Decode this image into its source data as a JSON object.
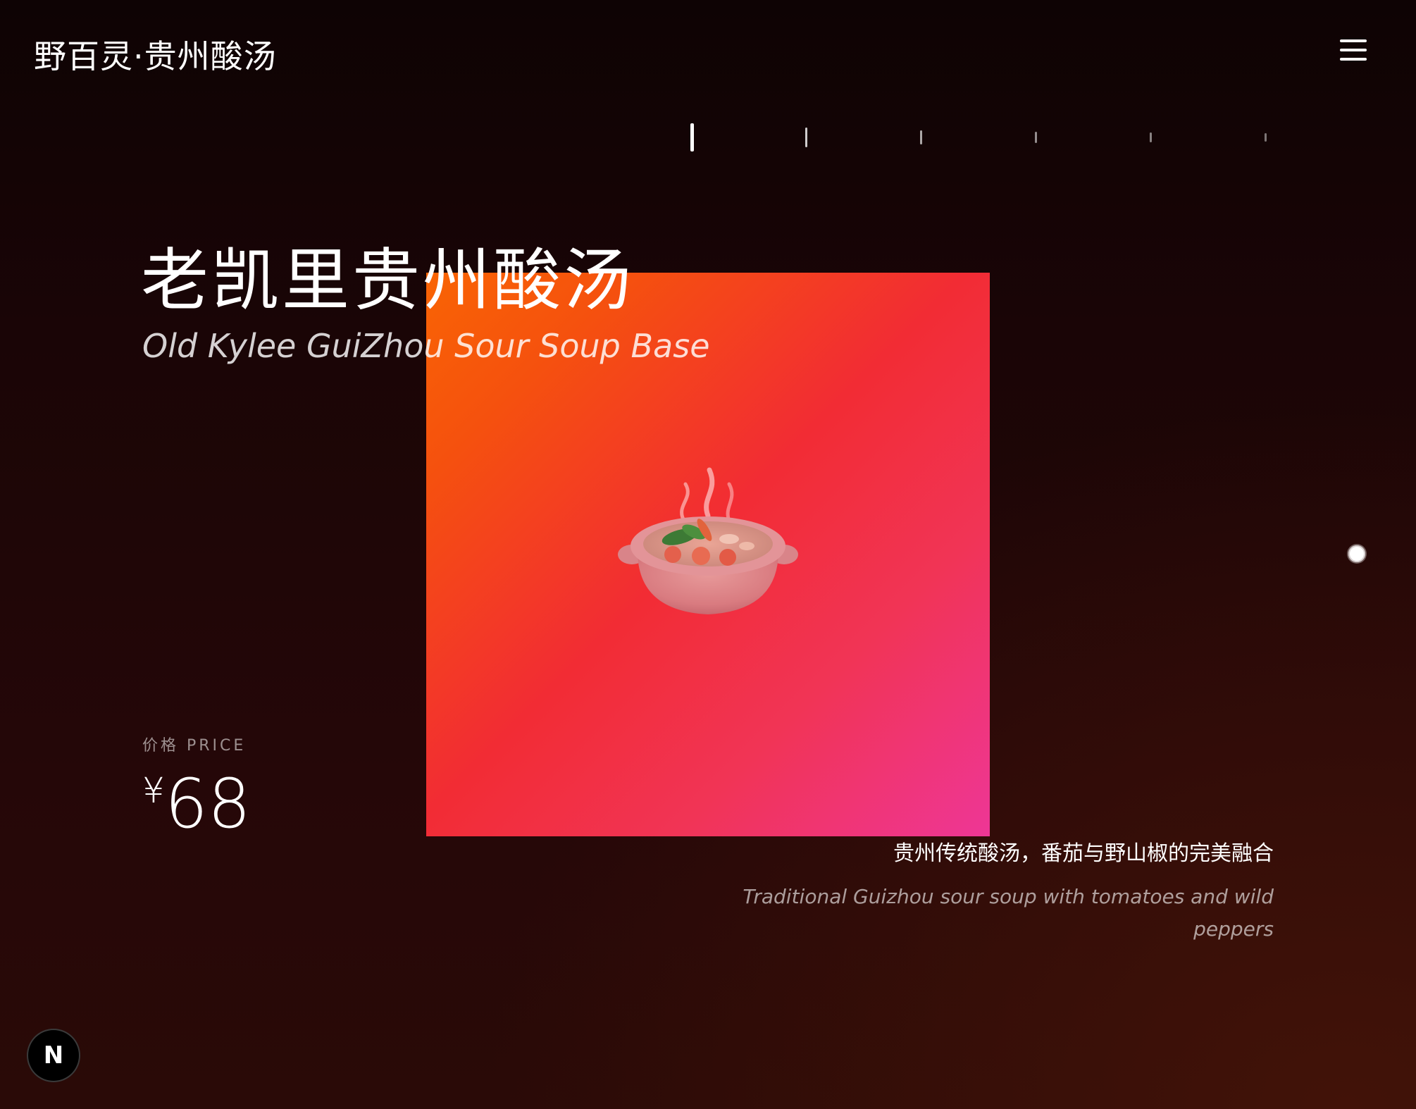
{
  "header": {
    "brand": "野百灵·贵州酸汤",
    "menu_icon": "hamburger-menu-icon"
  },
  "carousel": {
    "slide_count": 6,
    "active_index": 0
  },
  "product": {
    "title_zh": "老凯里贵州酸汤",
    "title_en": "Old Kylee GuiZhou Sour Soup Base",
    "image_icon": "soup-pot-icon",
    "card_gradient": [
      "#f96404",
      "#f22c34",
      "#ee3696"
    ],
    "price_label": "价格 PRICE",
    "currency": "¥",
    "price": "68",
    "description_zh": "贵州传统酸汤，番茄与野山椒的完美融合",
    "description_en": "Traditional Guizhou sour soup with tomatoes and wild peppers"
  },
  "scroll_indicator": {
    "icon": "scroll-dot-icon"
  },
  "footer": {
    "badge_letter": "N",
    "badge_icon": "nextjs-logo-icon"
  }
}
